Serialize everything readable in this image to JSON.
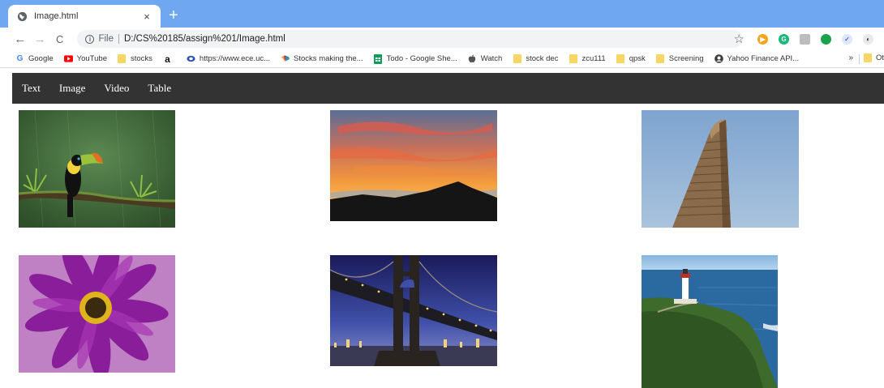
{
  "tab": {
    "title": "Image.html",
    "close_glyph": "×",
    "new_tab_glyph": "+"
  },
  "toolbar": {
    "back_glyph": "←",
    "forward_glyph": "→",
    "reload_glyph": "C",
    "scheme": "File",
    "url": "D:/CS%20185/assign%201/Image.html",
    "star_glyph": "☆"
  },
  "bookmarks": [
    {
      "label": "Google",
      "icon": "google-icon"
    },
    {
      "label": "YouTube",
      "icon": "youtube-icon"
    },
    {
      "label": "stocks",
      "icon": "folder-icon"
    },
    {
      "label": "",
      "icon": "amazon-icon"
    },
    {
      "label": "https://www.ece.uc...",
      "icon": "ece-icon"
    },
    {
      "label": "Stocks making the...",
      "icon": "cnbc-icon"
    },
    {
      "label": "Todo - Google She...",
      "icon": "sheets-icon"
    },
    {
      "label": "Watch",
      "icon": "apple-icon"
    },
    {
      "label": "stock dec",
      "icon": "folder-icon"
    },
    {
      "label": "zcu111",
      "icon": "folder-icon"
    },
    {
      "label": "qpsk",
      "icon": "folder-icon"
    },
    {
      "label": "Screening",
      "icon": "folder-icon"
    },
    {
      "label": "Yahoo Finance API...",
      "icon": "yahoo-icon"
    }
  ],
  "bookmarks_more": "»",
  "bookmarks_other": "Ot",
  "amazon_glyph": "a",
  "google_glyph": "G",
  "site_nav": {
    "items": [
      "Text",
      "Image",
      "Video",
      "Table"
    ]
  },
  "photos": [
    {
      "subject": "toucan"
    },
    {
      "subject": "sunset-mountain"
    },
    {
      "subject": "flatiron-building"
    },
    {
      "subject": "purple-flower"
    },
    {
      "subject": "bridge-at-night"
    },
    {
      "subject": "lighthouse"
    }
  ],
  "colors": {
    "tabstrip": "#6fa8f0",
    "site_nav_bg": "#333333",
    "site_nav_text": "#ffffff",
    "omnibox_bg": "#f1f3f4"
  }
}
